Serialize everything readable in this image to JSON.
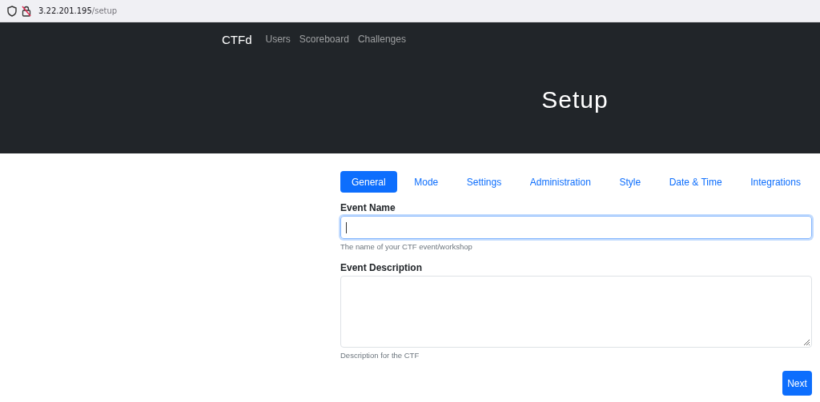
{
  "browser": {
    "address_host": "3.22.201.195",
    "address_path": "/setup"
  },
  "navbar": {
    "brand": "CTFd",
    "links": [
      "Users",
      "Scoreboard",
      "Challenges"
    ]
  },
  "header": {
    "title": "Setup"
  },
  "tabs": [
    {
      "label": "General",
      "selected": true
    },
    {
      "label": "Mode",
      "selected": false
    },
    {
      "label": "Settings",
      "selected": false
    },
    {
      "label": "Administration",
      "selected": false
    },
    {
      "label": "Style",
      "selected": false
    },
    {
      "label": "Date & Time",
      "selected": false
    },
    {
      "label": "Integrations",
      "selected": false
    }
  ],
  "fields": [
    {
      "kind": "input",
      "label": "Event Name",
      "help": "The name of your CTF event/workshop",
      "focused": true
    },
    {
      "kind": "textarea",
      "label": "Event Description",
      "help": "Description for the CTF",
      "focused": false
    }
  ],
  "buttons": [
    "Next"
  ]
}
